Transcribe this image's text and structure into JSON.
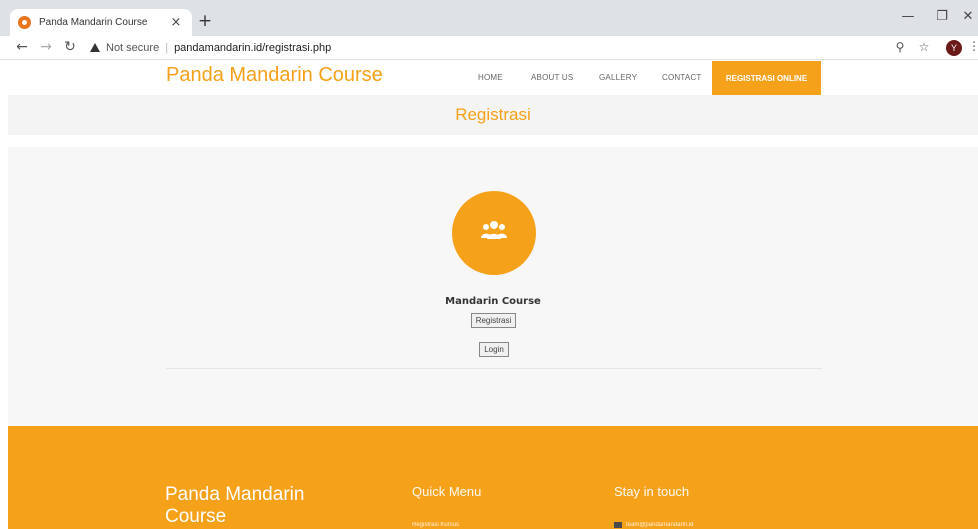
{
  "browser": {
    "tab_title": "Panda Mandarin Course",
    "tab_close": "×",
    "new_tab": "+",
    "not_secure": "Not secure",
    "url": "pandamandarin.id/registrasi.php",
    "avatar_letter": "Y",
    "icons": [
      "back-icon",
      "forward-icon",
      "reload-icon",
      "warning-icon",
      "zoom-icon",
      "star-icon",
      "menu-icon"
    ]
  },
  "header": {
    "brand": "Panda Mandarin Course",
    "nav": [
      {
        "label": "HOME"
      },
      {
        "label": "ABOUT US"
      },
      {
        "label": "GALLERY"
      },
      {
        "label": "CONTACT"
      }
    ],
    "cta": "REGISTRASI ONLINE"
  },
  "banner": {
    "title": "Registrasi"
  },
  "main": {
    "course_name": "Mandarin Course",
    "register_button": "Registrasi",
    "login_button": "Login"
  },
  "footer": {
    "brand": "Panda Mandarin Course",
    "quick_menu_title": "Quick Menu",
    "quick_menu_first": "Registrasi Kursus",
    "stay_title": "Stay in touch",
    "email": "team@pandamandarin.id"
  },
  "colors": {
    "accent": "#f6a11a",
    "banner_bg": "#f4f4f4",
    "content_bg": "#f7f7f7"
  }
}
